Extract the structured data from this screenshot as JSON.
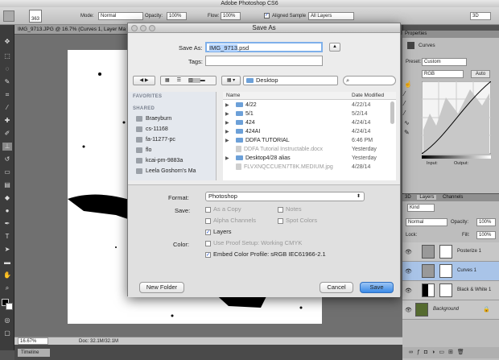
{
  "app": {
    "title": "Adobe Photoshop CS6"
  },
  "options_bar": {
    "brush_size": "363",
    "mode_label": "Mode:",
    "mode_value": "Normal",
    "opacity_label": "Opacity:",
    "opacity_value": "100%",
    "flow_label": "Flow:",
    "flow_value": "100%",
    "aligned_label": "Aligned Sample",
    "sample_value": "All Layers",
    "workspace": "3D"
  },
  "document": {
    "tab_title": "IMG_9713.JPG @ 16.7% (Curves 1, Layer Ma",
    "zoom": "16.67%",
    "doc_size": "Doc: 32.1M/32.1M"
  },
  "timeline": {
    "label": "Timeline"
  },
  "dialog": {
    "title": "Save As",
    "save_as_label": "Save As:",
    "filename_selected": "IMG_9713",
    "filename_ext": ".psd",
    "tags_label": "Tags:",
    "location": "Desktop",
    "sidebar": {
      "favorites_header": "FAVORITES",
      "shared_header": "SHARED",
      "items": [
        "Braeyburn",
        "cs-11168",
        "fa-11277-pc",
        "flo",
        "kcai-pm-9883a",
        "Leela Goshorn's Ma"
      ]
    },
    "file_list": {
      "col_name": "Name",
      "col_date": "Date Modified",
      "rows": [
        {
          "name": "4/22",
          "date": "4/22/14",
          "folder": true,
          "dim": false
        },
        {
          "name": "5/1",
          "date": "5/2/14",
          "folder": true,
          "dim": false
        },
        {
          "name": "424",
          "date": "4/24/14",
          "folder": true,
          "dim": false
        },
        {
          "name": "424AI",
          "date": "4/24/14",
          "folder": true,
          "dim": false
        },
        {
          "name": "DDFA TUTORIAL",
          "date": "6:46 PM",
          "folder": true,
          "dim": false
        },
        {
          "name": "DDFA Tutorial Instructable.docx",
          "date": "Yesterday",
          "folder": false,
          "dim": true
        },
        {
          "name": "Desktop4/28 alias",
          "date": "Yesterday",
          "folder": true,
          "dim": false
        },
        {
          "name": "FLVXNQCCUEN7T8K.MEDIUM.jpg",
          "date": "4/28/14",
          "folder": false,
          "dim": true
        }
      ]
    },
    "format_label": "Format:",
    "format_value": "Photoshop",
    "save_label": "Save:",
    "as_copy": "As a Copy",
    "notes": "Notes",
    "alpha_channels": "Alpha Channels",
    "spot_colors": "Spot Colors",
    "layers": "Layers",
    "color_label": "Color:",
    "proof_setup": "Use Proof Setup:  Working CMYK",
    "embed_profile": "Embed Color Profile:  sRGB IEC61966-2.1",
    "new_folder_button": "New Folder",
    "cancel_button": "Cancel",
    "save_button": "Save"
  },
  "properties": {
    "tab": "Properties",
    "panel_name": "Curves",
    "preset_label": "Preset:",
    "preset_value": "Custom",
    "channel_value": "RGB",
    "auto_button": "Auto",
    "input_label": "Input:",
    "output_label": "Output:"
  },
  "layers_panel": {
    "tabs": [
      "3D",
      "Layers",
      "Channels"
    ],
    "kind_value": "Kind",
    "blend_value": "Normal",
    "opacity_label": "Opacity:",
    "opacity_value": "100%",
    "lock_label": "Lock:",
    "fill_label": "Fill:",
    "fill_value": "100%",
    "layers": [
      "Posterize 1",
      "Curves 1",
      "Black & White 1",
      "Background"
    ]
  },
  "colors": {
    "accent": "#1a64d6",
    "panel": "#bdbdbd",
    "dark": "#535353"
  }
}
